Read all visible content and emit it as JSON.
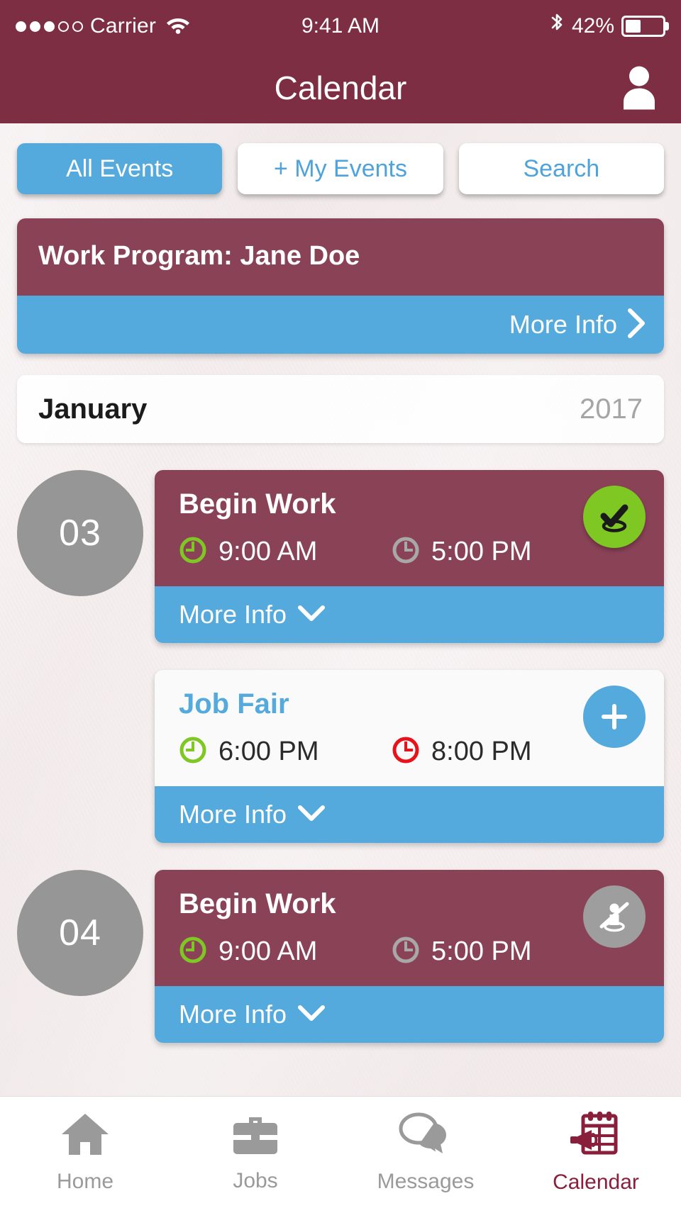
{
  "statusbar": {
    "carrier": "Carrier",
    "signal_filled": 3,
    "signal_empty": 2,
    "wifi_icon": "wifi-icon",
    "time": "9:41 AM",
    "bluetooth_icon": "bluetooth-icon",
    "battery_percent": "42%",
    "battery_level": 42
  },
  "navbar": {
    "title": "Calendar",
    "profile_icon": "profile-icon"
  },
  "filters": [
    {
      "label": "All Events",
      "active": true
    },
    {
      "label": "+ My Events",
      "active": false
    },
    {
      "label": "Search",
      "active": false
    }
  ],
  "program": {
    "title": "Work Program: Jane Doe",
    "more_info_label": "More Info",
    "chevron_icon": "chevron-right-icon"
  },
  "month": {
    "name": "January",
    "year": "2017"
  },
  "events": [
    {
      "day": "03",
      "show_day": true,
      "title": "Begin Work",
      "style": "maroon",
      "start_time": "9:00 AM",
      "end_time": "5:00 PM",
      "start_icon": "clock-green-icon",
      "end_icon": "clock-gray-icon",
      "badge": "check-in-complete-icon",
      "badge_style": "green",
      "more_info_label": "More Info",
      "chevron_icon": "chevron-down-icon"
    },
    {
      "day": "",
      "show_day": false,
      "title": "Job Fair",
      "style": "white",
      "start_time": "6:00 PM",
      "end_time": "8:00 PM",
      "start_icon": "clock-green-icon",
      "end_icon": "clock-red-icon",
      "badge": "add-event-icon",
      "badge_style": "plus",
      "more_info_label": "More Info",
      "chevron_icon": "chevron-down-icon"
    },
    {
      "day": "04",
      "show_day": true,
      "title": "Begin Work",
      "style": "maroon",
      "start_time": "9:00 AM",
      "end_time": "5:00 PM",
      "start_icon": "clock-green-icon",
      "end_icon": "clock-gray-icon",
      "badge": "check-in-unavailable-icon",
      "badge_style": "gray",
      "more_info_label": "More Info",
      "chevron_icon": "chevron-down-icon"
    }
  ],
  "tabbar": [
    {
      "label": "Home",
      "icon": "home-icon",
      "active": false
    },
    {
      "label": "Jobs",
      "icon": "briefcase-icon",
      "active": false
    },
    {
      "label": "Messages",
      "icon": "chat-bubbles-icon",
      "active": false
    },
    {
      "label": "Calendar",
      "icon": "calendar-megaphone-icon",
      "active": true
    }
  ],
  "colors": {
    "brand_maroon": "#7d2e42",
    "card_maroon": "#8a4257",
    "accent_blue": "#54a9dd",
    "green": "#7fc723",
    "red": "#e8121b",
    "gray": "#969696",
    "background": "#f2eaeb"
  }
}
